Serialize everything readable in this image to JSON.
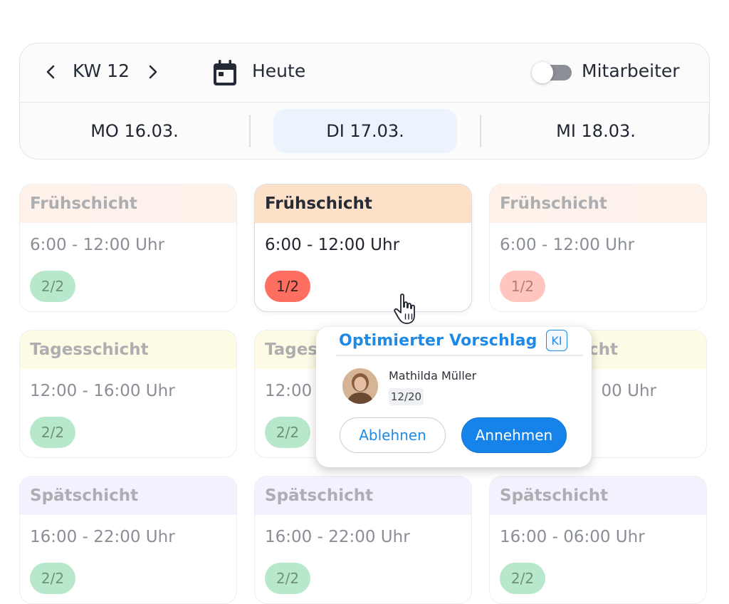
{
  "header": {
    "week_label": "KW 12",
    "today_label": "Heute",
    "staff_toggle_label": "Mitarbeiter",
    "staff_toggle_on": false
  },
  "days": [
    {
      "label": "MO 16.03.",
      "active": false
    },
    {
      "label": "DI 17.03.",
      "active": true
    },
    {
      "label": "MI 18.03.",
      "active": false
    }
  ],
  "shifts": {
    "early": {
      "name": "Frühschicht",
      "times": [
        "6:00 - 12:00 Uhr",
        "6:00 - 12:00 Uhr",
        "6:00 - 12:00 Uhr"
      ],
      "staffing": [
        "2/2",
        "1/2",
        "1/2"
      ]
    },
    "day": {
      "name": "Tagesschicht",
      "names_visible": [
        "Tagesschicht",
        "Tages",
        "cht"
      ],
      "times": [
        "12:00 - 16:00 Uhr",
        "12:00",
        "00 Uhr"
      ],
      "staffing": [
        "2/2",
        "2/2"
      ]
    },
    "late": {
      "name": "Spätschicht",
      "times": [
        "16:00 - 22:00 Uhr",
        "16:00 - 22:00 Uhr",
        "16:00 - 06:00 Uhr"
      ],
      "staffing": [
        "2/2",
        "2/2",
        "2/2"
      ]
    }
  },
  "suggestion": {
    "title": "Optimierter Vorschlag",
    "ai_badge": "KI",
    "employee_name": "Mathilda Müller",
    "employee_hours": "12/20",
    "reject_label": "Ablehnen",
    "accept_label": "Annehmen"
  },
  "colors": {
    "accent": "#1583e9",
    "early_header": "#fdebdf",
    "day_header": "#fcf8d7",
    "late_header": "#efe7fc",
    "ok_badge": "#b8e8cb",
    "understaffed_badge": "#ff6f61",
    "active_day": "#ecf3fd"
  }
}
